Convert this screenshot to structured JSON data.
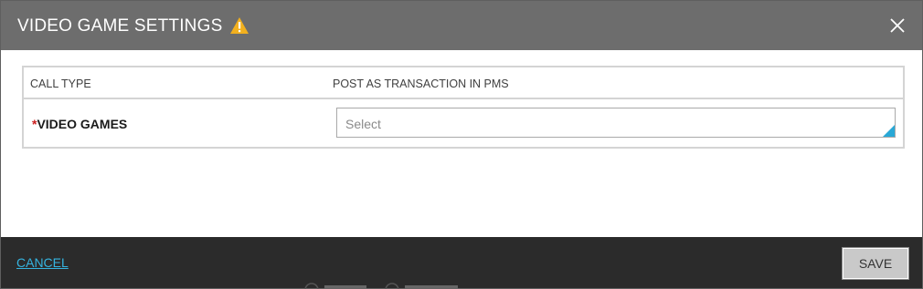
{
  "dialog": {
    "title": "VIDEO GAME SETTINGS",
    "warning_icon": "warning-triangle-icon",
    "close_icon": "close-icon"
  },
  "table": {
    "headers": {
      "call_type": "CALL TYPE",
      "post_transaction": "POST AS TRANSACTION IN PMS"
    },
    "rows": [
      {
        "required_marker": "*",
        "label": "VIDEO GAMES",
        "select_placeholder": "Select"
      }
    ]
  },
  "footer": {
    "cancel_label": "CANCEL",
    "save_label": "SAVE"
  },
  "colors": {
    "header_bg": "#6d6d6d",
    "footer_bg": "#2b2b2b",
    "link": "#35b4e0",
    "required": "#cc1f1f",
    "warning": "#f2b01e",
    "select_corner": "#29a8d6"
  }
}
